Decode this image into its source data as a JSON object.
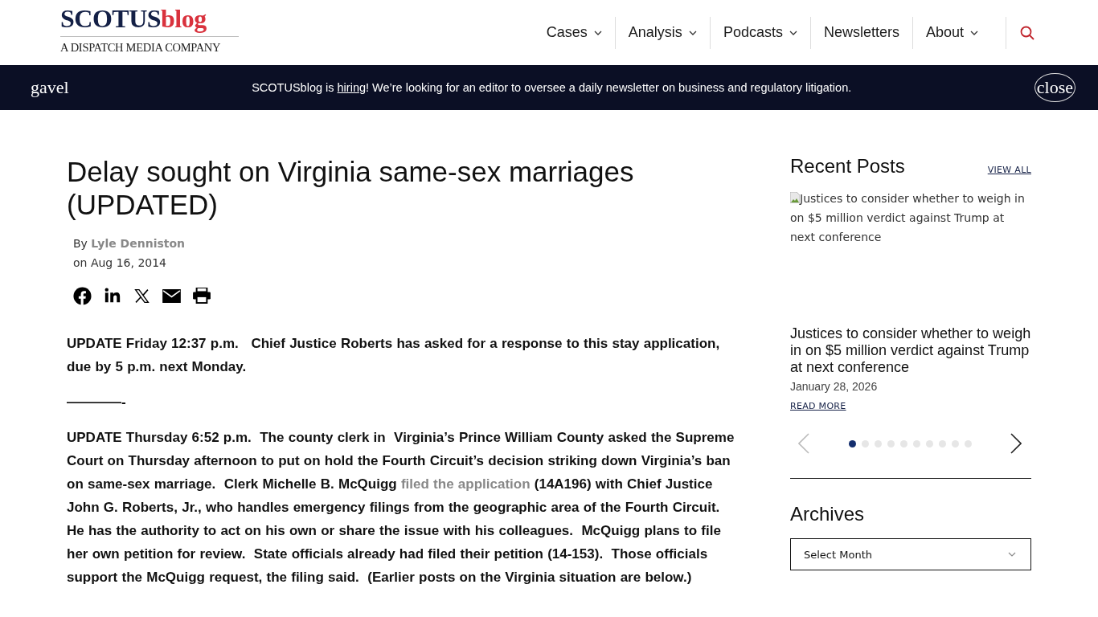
{
  "logo": {
    "wordmark_main": "SCOTUS",
    "wordmark_accent": "blog",
    "tagline": "A DISPATCH MEDIA COMPANY"
  },
  "nav": [
    {
      "label": "Cases",
      "dropdown": true
    },
    {
      "label": "Analysis",
      "dropdown": true
    },
    {
      "label": "Podcasts",
      "dropdown": true
    },
    {
      "label": "Newsletters",
      "dropdown": false
    },
    {
      "label": "About",
      "dropdown": true
    }
  ],
  "banner": {
    "icon_text": "gavel",
    "before": "SCOTUSblog is ",
    "link": "hiring",
    "after": "! We’re looking for an editor to oversee a daily newsletter on business and regulatory litigation.",
    "close_text": "close"
  },
  "article": {
    "title": "Delay sought on Virginia same-sex marriages (UPDATED)",
    "by": "By",
    "author": "Lyle Denniston",
    "date": "on Aug 16, 2014",
    "share": [
      {
        "kind": "facebook"
      },
      {
        "kind": "linkedin"
      },
      {
        "kind": "x"
      },
      {
        "kind": "email"
      },
      {
        "kind": "print"
      }
    ],
    "blocks": [
      {
        "kind": "paragraph",
        "text": "UPDATE Friday 12:37 p.m.   Chief Justice Roberts has asked for a response to this stay application, due by 5 p.m. next Monday."
      },
      {
        "kind": "separator",
        "text": "————-"
      },
      {
        "kind": "linked_paragraph",
        "before": "UPDATE Thursday 6:52 p.m.  The county clerk in  Virginia’s Prince William County asked the Supreme Court on Thursday afternoon to put on hold the Fourth Circuit’s decision striking down Virginia’s ban on same-sex marriage.  Clerk Michelle B. McQuigg ",
        "link": "filed the application",
        "after": " (14A196) with Chief Justice John G. Roberts, Jr., who handles emergency filings from the geographic area of the Fourth Circuit.  He has the authority to act on his own or share the issue with his colleagues.  McQuigg plans to file her own petition for review.  State officials already had filed their petition (14-153).  Those officials support the McQuigg request, the filing said.  (Earlier posts on the Virginia situation are below.)"
      }
    ]
  },
  "recent_posts": {
    "heading": "Recent Posts",
    "view_all": "VIEW ALL",
    "image_alt": "Justices to consider whether to weigh in on $5 million verdict against Trump at next conference",
    "post_title": "Justices to consider whether to weigh in on $5 million verdict against Trump at next conference",
    "post_date": "January 28, 2026",
    "read_more": "READ MORE",
    "dots": [
      {
        "selected": true
      },
      {
        "selected": false
      },
      {
        "selected": false
      },
      {
        "selected": false
      },
      {
        "selected": false
      },
      {
        "selected": false
      },
      {
        "selected": false
      },
      {
        "selected": false
      },
      {
        "selected": false
      },
      {
        "selected": false
      }
    ]
  },
  "archives": {
    "heading": "Archives",
    "select": "Select Month"
  }
}
